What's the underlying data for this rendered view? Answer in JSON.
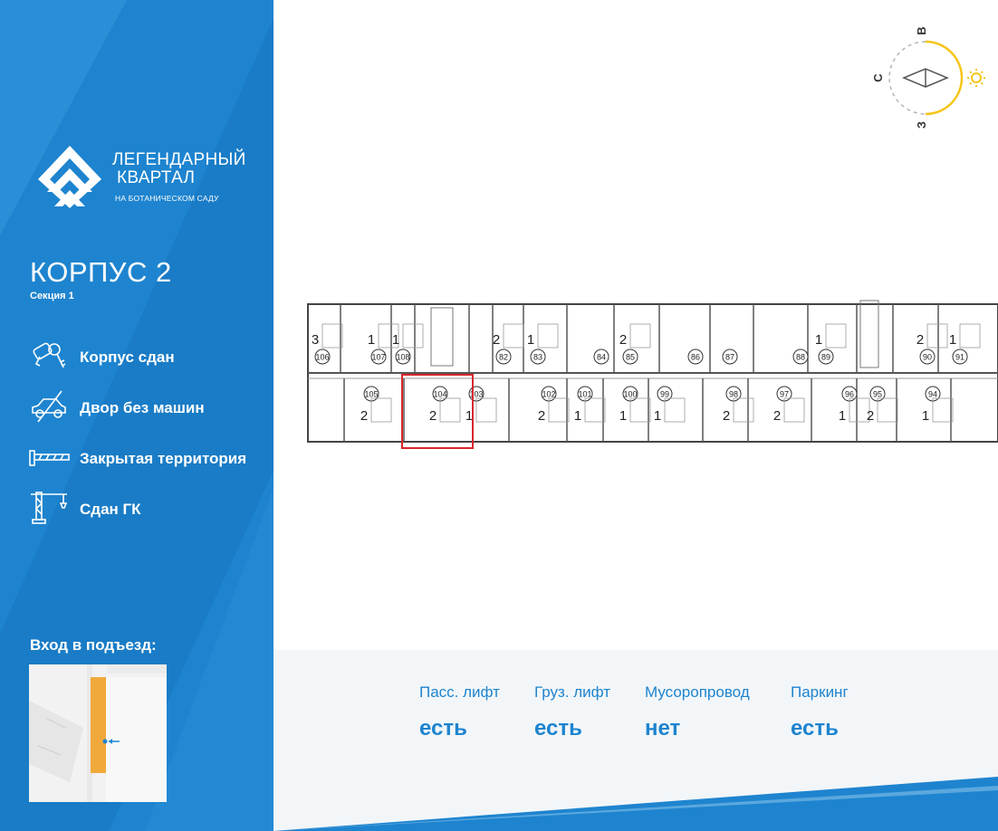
{
  "brand": {
    "line1": "ЛЕГЕНДАРНЫЙ",
    "line2": "КВАРТАЛ",
    "line3": "НА БОТАНИЧЕСКОМ САДУ"
  },
  "building": {
    "title": "КОРПУС 2",
    "section": "Секция 1"
  },
  "features": [
    {
      "icon": "keys-icon",
      "label": "Корпус сдан"
    },
    {
      "icon": "no-car-icon",
      "label": "Двор без машин"
    },
    {
      "icon": "barrier-icon",
      "label": "Закрытая территория"
    },
    {
      "icon": "crane-icon",
      "label": "Сдан ГК"
    }
  ],
  "entrance": {
    "label": "Вход в подъезд:"
  },
  "compass": {
    "north": "С",
    "east": "В",
    "west": "З"
  },
  "floor_plan": {
    "top_row": [
      "106",
      "107",
      "108",
      "82",
      "83",
      "84",
      "85",
      "86",
      "87",
      "88",
      "89",
      "90",
      "91"
    ],
    "bottom_row": [
      "105",
      "104",
      "103",
      "102",
      "101",
      "100",
      "99",
      "98",
      "97",
      "96",
      "95",
      "94"
    ],
    "highlighted_apartment": "104",
    "top_room_counts": [
      "3",
      "1",
      "1",
      "2",
      "1",
      "",
      "2",
      "",
      "",
      "",
      "1",
      "2",
      "1"
    ],
    "bottom_room_counts": [
      "2",
      "2",
      "1",
      "2",
      "1",
      "1",
      "1",
      "2",
      "2",
      "1",
      "2",
      "1"
    ]
  },
  "amenities": [
    {
      "label": "Пасс. лифт",
      "value": "есть"
    },
    {
      "label": "Груз. лифт",
      "value": "есть"
    },
    {
      "label": "Мусоропровод",
      "value": "нет"
    },
    {
      "label": "Паркинг",
      "value": "есть"
    }
  ],
  "colors": {
    "brand_blue": "#1e84cf",
    "sun_yellow": "#f5c518",
    "highlight_red": "#d9262c",
    "entrance_orange": "#f2a93b"
  }
}
